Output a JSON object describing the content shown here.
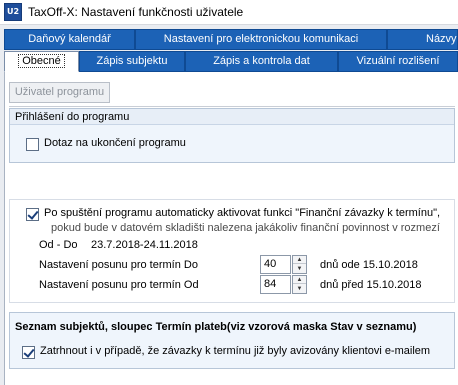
{
  "window": {
    "app_icon_text": "U2",
    "title": "TaxOff-X: Nastavení funkčnosti uživatele"
  },
  "tabs_row1": [
    "Daňový kalendář",
    "Nastavení pro elektronickou komunikaci",
    "Názvy"
  ],
  "tabs_row2": [
    "Obecné",
    "Zápis subjektu",
    "Zápis a kontrola dat",
    "Vizuální rozlišení"
  ],
  "user_button_label": "Uživatel programu",
  "login_section": {
    "title": "Přihlášení do programu",
    "confirm_exit_label": "Dotaz na ukončení programu",
    "confirm_exit_checked": false
  },
  "auto_activation": {
    "checked": true,
    "line1": "Po spuštění programu automaticky aktivovat funkci \"Finanční závazky k termínu\",",
    "line2": "pokud bude v datovém skladišti nalezena jakákoliv finanční povinnost v rozmezí",
    "range_label": "Od - Do",
    "range_value": "23.7.2018-24.11.2018",
    "shift_do_label": "Nastavení posunu pro termín Do",
    "shift_do_value": "40",
    "shift_do_desc": "dnů ode 15.10.2018",
    "shift_od_label": "Nastavení posunu pro termín Od",
    "shift_od_value": "84",
    "shift_od_desc": "dnů před 15.10.2018"
  },
  "subject_list": {
    "title": "Seznam subjektů, sloupec Termín plateb(viz vzorová maska Stav v seznamu)",
    "strike_label": "Zatrhnout i v případě, že závazky k termínu již byly avizovány klientovi e-mailem",
    "strike_checked": true
  },
  "colors": {
    "tab_blue": "#1c62b6",
    "panel_bg": "#eff5fc"
  }
}
